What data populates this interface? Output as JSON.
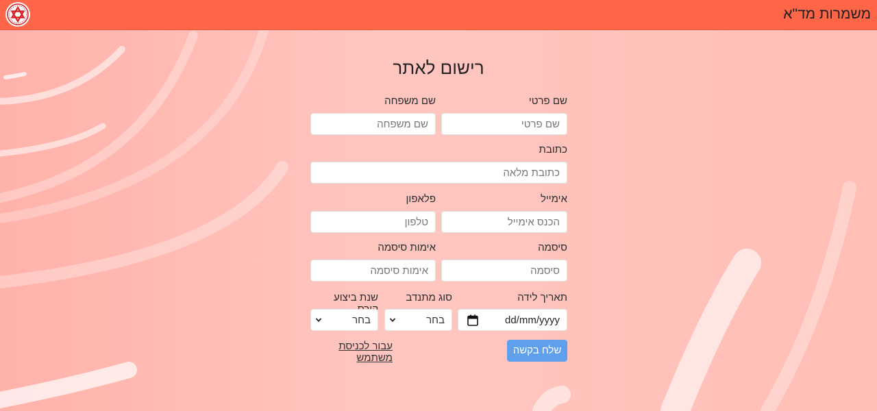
{
  "header": {
    "site_title": "משמרות מד\"א",
    "logo": "mda-star-of-david-logo"
  },
  "form": {
    "title": "רישום לאתר",
    "first_name": {
      "label": "שם פרטי",
      "placeholder": "שם פרטי"
    },
    "last_name": {
      "label": "שם משפחה",
      "placeholder": "שם משפחה"
    },
    "address": {
      "label": "כתובת",
      "placeholder": "כתובת מלאה"
    },
    "email": {
      "label": "אימייל",
      "placeholder": "הכנס אימייל"
    },
    "phone": {
      "label": "פלאפון",
      "placeholder": "טלפון"
    },
    "password": {
      "label": "סיסמה",
      "placeholder": "סיסמה"
    },
    "password_confirm": {
      "label": "אימות סיסמה",
      "placeholder": "אימות סיסמה"
    },
    "birth_date": {
      "label": "תאריך לידה",
      "value": "dd/mm/yyyy",
      "icon": "calendar-icon"
    },
    "volunteer_type": {
      "label": "סוג מתנדב",
      "value": "בחר"
    },
    "course_year": {
      "label": "שנת ביצוע קורס",
      "value": "בחר"
    },
    "submit_label": "שלח בקשה",
    "login_link": "עבור לכניסת משתמש"
  },
  "colors": {
    "header_bg": "#ff6547",
    "background": "#ffc2bb",
    "submit_bg": "#5fa0ec",
    "logo_red": "#d71920"
  }
}
